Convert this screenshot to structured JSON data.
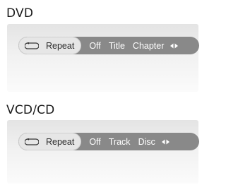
{
  "sections": [
    {
      "title": "DVD",
      "repeat_label": "Repeat",
      "options": [
        "Off",
        "Title",
        "Chapter"
      ],
      "icon": "loop-icon",
      "nav_icon": "left-right-arrows-icon"
    },
    {
      "title": "VCD/CD",
      "repeat_label": "Repeat",
      "options": [
        "Off",
        "Track",
        "Disc"
      ],
      "icon": "loop-icon",
      "nav_icon": "left-right-arrows-icon"
    }
  ],
  "colors": {
    "bar": "#898989",
    "selected_pill": "#e6e6e6",
    "option_text": "#ffffff"
  }
}
